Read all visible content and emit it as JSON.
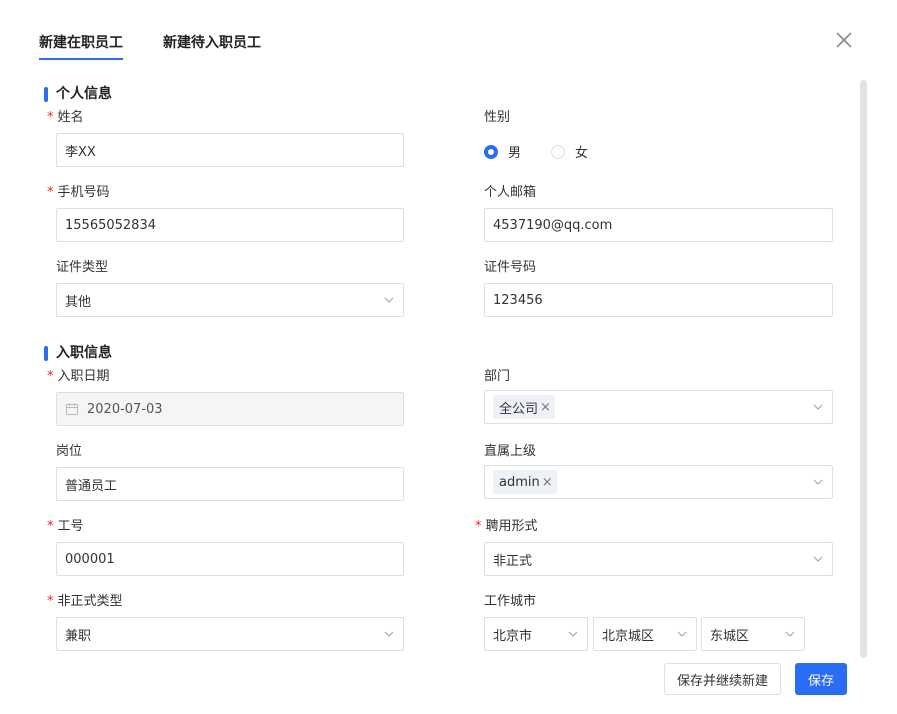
{
  "tabs": [
    {
      "label": "新建在职员工",
      "active": true
    },
    {
      "label": "新建待入职员工",
      "active": false
    }
  ],
  "sections": {
    "personal": "个人信息",
    "onboarding": "入职信息"
  },
  "personal": {
    "name": {
      "label": "姓名",
      "required": "*",
      "value": "李XX"
    },
    "gender": {
      "label": "性别",
      "options": [
        "男",
        "女"
      ],
      "selected": "男"
    },
    "phone": {
      "label": "手机号码",
      "required": "*",
      "value": "15565052834"
    },
    "email": {
      "label": "个人邮箱",
      "value": "4537190@qq.com"
    },
    "id_type": {
      "label": "证件类型",
      "value": "其他"
    },
    "id_number": {
      "label": "证件号码",
      "value": "123456"
    }
  },
  "onboarding": {
    "join_date": {
      "label": "入职日期",
      "required": "*",
      "value": "2020-07-03"
    },
    "department": {
      "label": "部门",
      "tag": "全公司",
      "remove": "×"
    },
    "position": {
      "label": "岗位",
      "value": "普通员工"
    },
    "supervisor": {
      "label": "直属上级",
      "tag": "admin",
      "remove": "×"
    },
    "employee_no": {
      "label": "工号",
      "required": "*",
      "value": "000001"
    },
    "employment_form": {
      "label": "聘用形式",
      "required": "*",
      "value": "非正式"
    },
    "informal_type": {
      "label": "非正式类型",
      "required": "*",
      "value": "兼职"
    },
    "work_city": {
      "label": "工作城市",
      "province": "北京市",
      "city": "北京城区",
      "district": "东城区"
    }
  },
  "buttons": {
    "save_continue": "保存并继续新建",
    "save": "保存"
  },
  "colors": {
    "accent": "#2b6cf5",
    "required": "#f5222d",
    "border": "#dcdfe6"
  }
}
